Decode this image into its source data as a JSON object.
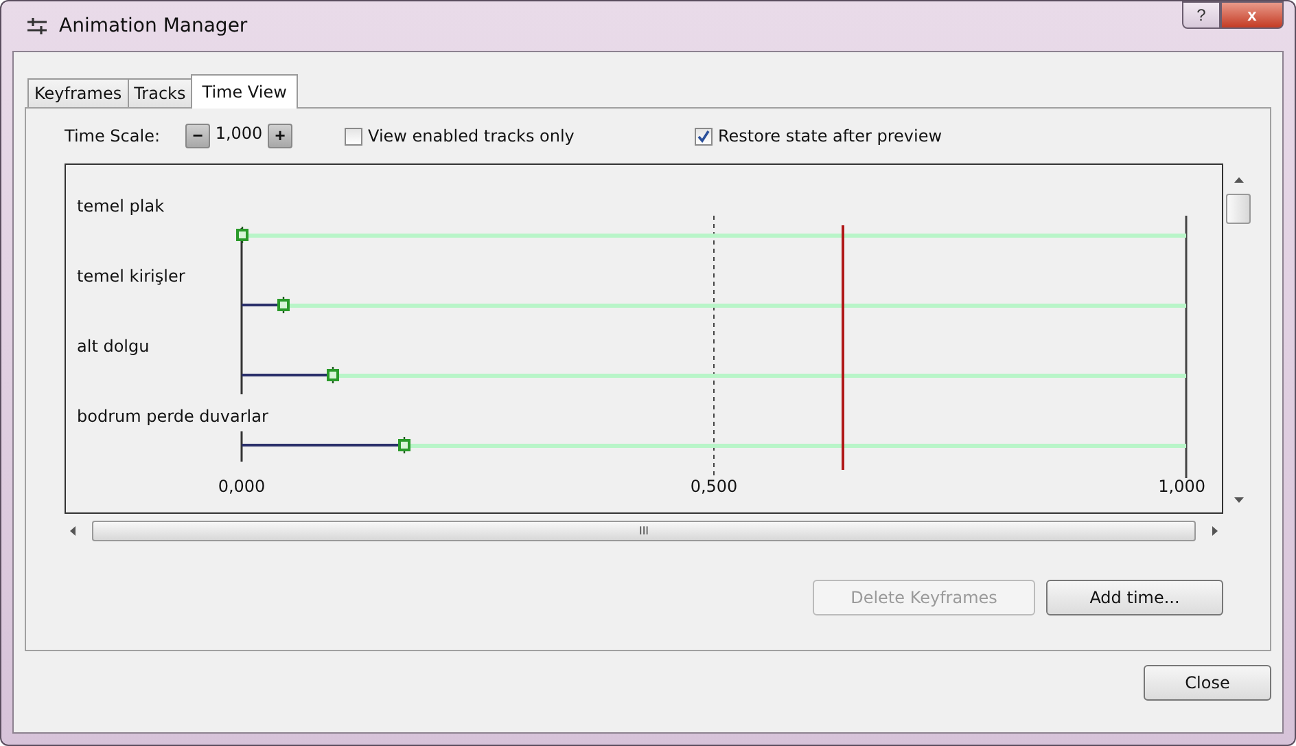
{
  "window": {
    "title": "Animation Manager",
    "buttons": [
      "?",
      "x"
    ]
  },
  "tabs": [
    {
      "label": "Keyframes",
      "selected": false
    },
    {
      "label": "Tracks",
      "selected": false
    },
    {
      "label": "Time View",
      "selected": true
    }
  ],
  "time_scale": {
    "label": "Time Scale:",
    "minus": "−",
    "value": "1,000",
    "plus": "+"
  },
  "options": [
    {
      "label": "View enabled tracks only",
      "checked": false
    },
    {
      "label": "Restore state after preview",
      "checked": true
    }
  ],
  "timeline": {
    "tracks": [
      {
        "name": "temel plak"
      },
      {
        "name": "temel kirişler"
      },
      {
        "name": "alt dolgu"
      },
      {
        "name": "bodrum perde duvarlar"
      }
    ],
    "playhead": {
      "level": 0.637
    },
    "ticks": [
      "0,000",
      "0,500",
      "1,000"
    ]
  },
  "scrollbar_label": "III",
  "buttons": [
    {
      "label": "Delete Keyframes",
      "disabled": true
    },
    {
      "label": "Add time...",
      "disabled": false
    }
  ],
  "footer": {
    "close": "Close"
  }
}
